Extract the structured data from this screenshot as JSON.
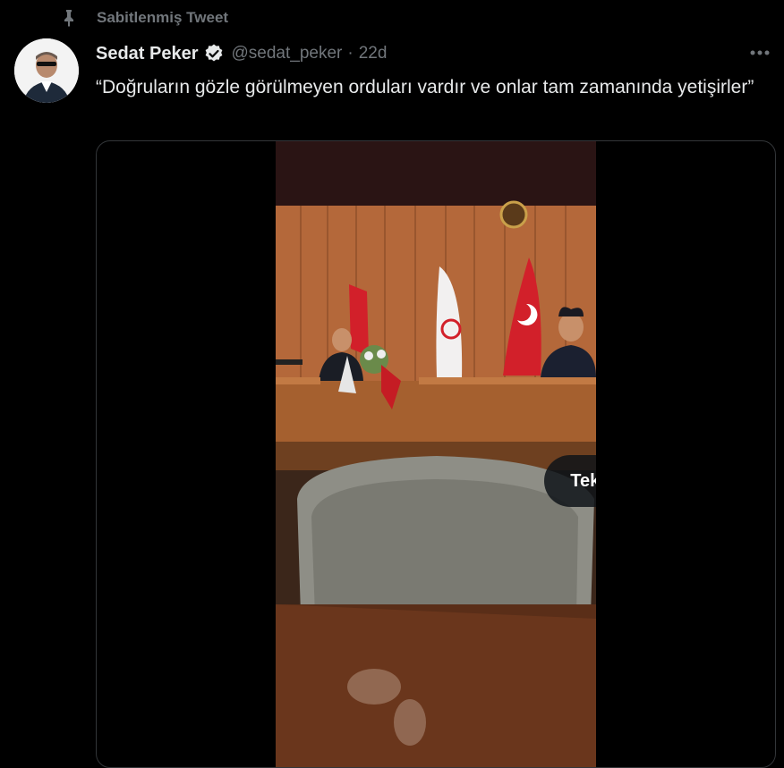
{
  "pinned": {
    "label": "Sabitlenmiş Tweet",
    "icon": "pin-icon"
  },
  "tweet": {
    "display_name": "Sedat Peker",
    "verified_icon": "verified-badge-icon",
    "handle": "@sedat_peker",
    "separator": "·",
    "time": "22d",
    "text": "“Doğruların gözle görülmeyen orduları vardır ve onlar tam zamanında yetişirler”"
  },
  "media": {
    "replay_label": "Tekrar izle"
  },
  "colors": {
    "background": "#000000",
    "primary_text": "#e7e9ea",
    "secondary_text": "#71767b",
    "verified": "#e7e9ea"
  }
}
